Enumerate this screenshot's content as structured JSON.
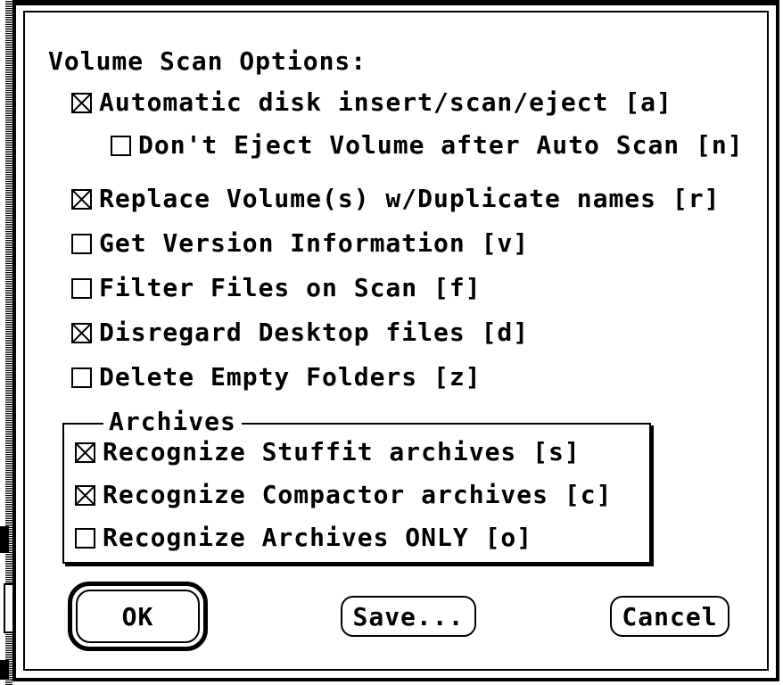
{
  "dialog": {
    "title": "Volume Scan Options:",
    "options": [
      {
        "label": "Automatic disk insert/scan/eject [a]",
        "checked": true
      },
      {
        "label": "Don't Eject Volume after Auto Scan [n]",
        "checked": false
      },
      {
        "label": "Replace Volume(s) w/Duplicate names [r]",
        "checked": true
      },
      {
        "label": "Get Version Information [v]",
        "checked": false
      },
      {
        "label": "Filter Files on Scan [f]",
        "checked": false
      },
      {
        "label": "Disregard Desktop files [d]",
        "checked": true
      },
      {
        "label": "Delete Empty Folders [z]",
        "checked": false
      }
    ],
    "archives": {
      "title": "Archives",
      "options": [
        {
          "label": "Recognize Stuffit archives [s]",
          "checked": true
        },
        {
          "label": "Recognize Compactor archives [c]",
          "checked": true
        },
        {
          "label": "Recognize Archives ONLY [o]",
          "checked": false
        }
      ]
    },
    "buttons": {
      "ok": "OK",
      "save": "Save...",
      "cancel": "Cancel"
    }
  }
}
